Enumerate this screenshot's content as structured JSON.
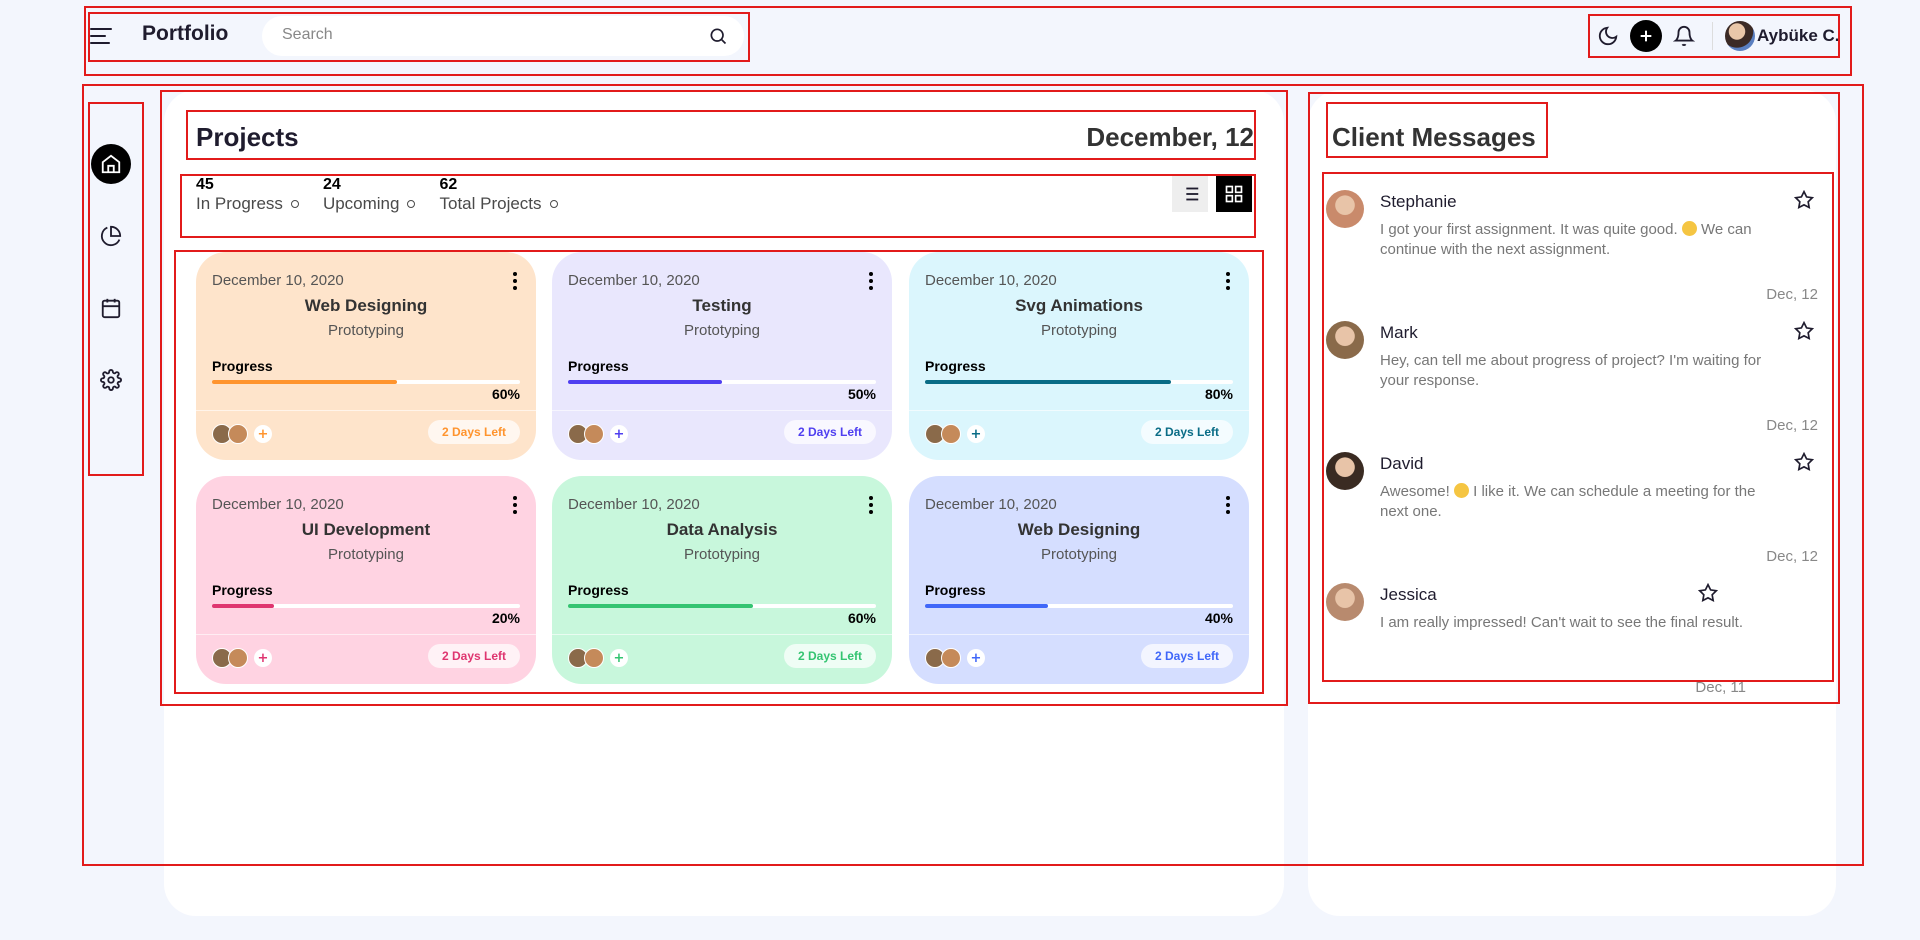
{
  "header": {
    "app_title": "Portfolio",
    "search_placeholder": "Search",
    "user_name": "Aybüke C."
  },
  "sidebar": {
    "items": [
      {
        "name": "home",
        "active": true
      },
      {
        "name": "chart"
      },
      {
        "name": "calendar"
      },
      {
        "name": "settings"
      }
    ]
  },
  "projects": {
    "title": "Projects",
    "date": "December, 12",
    "stats": [
      {
        "value": "45",
        "label": "In Progress"
      },
      {
        "value": "24",
        "label": "Upcoming"
      },
      {
        "value": "62",
        "label": "Total Projects"
      }
    ],
    "progress_label": "Progress",
    "cards": [
      {
        "date": "December 10, 2020",
        "title": "Web Designing",
        "subtitle": "Prototyping",
        "progress": "60%",
        "days_left": "2 Days Left",
        "bg": "#fee4cb",
        "accent": "#ff942e"
      },
      {
        "date": "December 10, 2020",
        "title": "Testing",
        "subtitle": "Prototyping",
        "progress": "50%",
        "days_left": "2 Days Left",
        "bg": "#e9e7fd",
        "accent": "#4f3ff0"
      },
      {
        "date": "December 10, 2020",
        "title": "Svg Animations",
        "subtitle": "Prototyping",
        "progress": "80%",
        "days_left": "2 Days Left",
        "bg": "#dbf6fd",
        "accent": "#096c86"
      },
      {
        "date": "December 10, 2020",
        "title": "UI Development",
        "subtitle": "Prototyping",
        "progress": "20%",
        "days_left": "2 Days Left",
        "bg": "#ffd3e2",
        "accent": "#df3670"
      },
      {
        "date": "December 10, 2020",
        "title": "Data Analysis",
        "subtitle": "Prototyping",
        "progress": "60%",
        "days_left": "2 Days Left",
        "bg": "#c8f7dc",
        "accent": "#34c471"
      },
      {
        "date": "December 10, 2020",
        "title": "Web Designing",
        "subtitle": "Prototyping",
        "progress": "40%",
        "days_left": "2 Days Left",
        "bg": "#d5deff",
        "accent": "#4067f9"
      }
    ]
  },
  "messages": {
    "title": "Client Messages",
    "items": [
      {
        "name": "Stephanie",
        "text_a": "I got your first assignment. It was quite good.",
        "text_b": "We can continue with the next assignment.",
        "date": "Dec, 12",
        "avatar_color": "#c98a6b"
      },
      {
        "name": "Mark",
        "text_a": "Hey, can tell me about progress of project? I'm waiting for your response.",
        "text_b": "",
        "date": "Dec, 12",
        "avatar_color": "#8a6a4a"
      },
      {
        "name": "David",
        "text_a": "Awesome!",
        "text_b": "I like it. We can schedule a meeting for the next one.",
        "date": "Dec, 12",
        "avatar_color": "#3a2b22"
      },
      {
        "name": "Jessica",
        "text_a": "I am really impressed! Can't wait to see the final result.",
        "text_b": "",
        "date": "Dec, 11",
        "avatar_color": "#b88a6e"
      }
    ]
  }
}
